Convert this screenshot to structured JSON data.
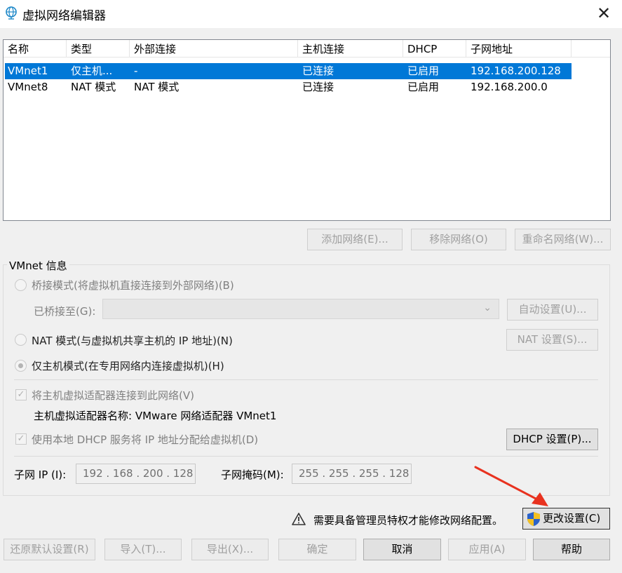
{
  "window": {
    "title": "虚拟网络编辑器",
    "close_glyph": "✕"
  },
  "list": {
    "headers": [
      "名称",
      "类型",
      "外部连接",
      "主机连接",
      "DHCP",
      "子网地址"
    ],
    "rows": [
      {
        "name": "VMnet1",
        "type": "仅主机...",
        "external": "-",
        "host": "已连接",
        "dhcp": "已启用",
        "subnet": "192.168.200.128",
        "selected": true
      },
      {
        "name": "VMnet8",
        "type": "NAT 模式",
        "external": "NAT 模式",
        "host": "已连接",
        "dhcp": "已启用",
        "subnet": "192.168.200.0",
        "selected": false
      }
    ]
  },
  "list_buttons": {
    "add": "添加网络(E)...",
    "remove": "移除网络(O)",
    "rename": "重命名网络(W)..."
  },
  "vmnet_info": {
    "group_label": "VMnet 信息",
    "bridge_mode": "桥接模式(将虚拟机直接连接到外部网络)(B)",
    "bridged_to_label": "已桥接至(G):",
    "auto_settings": "自动设置(U)...",
    "nat_mode": "NAT 模式(与虚拟机共享主机的 IP 地址)(N)",
    "nat_settings": "NAT 设置(S)...",
    "host_only_mode": "仅主机模式(在专用网络内连接虚拟机)(H)",
    "connect_adapter": "将主机虚拟适配器连接到此网络(V)",
    "adapter_name": "主机虚拟适配器名称: VMware 网络适配器 VMnet1",
    "use_dhcp": "使用本地 DHCP 服务将 IP 地址分配给虚拟机(D)",
    "dhcp_settings": "DHCP 设置(P)...",
    "subnet_ip_label": "子网 IP (I):",
    "subnet_ip": "192 . 168 . 200 . 128",
    "subnet_mask_label": "子网掩码(M):",
    "subnet_mask": "255 . 255 . 255 . 128"
  },
  "admin_notice": {
    "text": "需要具备管理员特权才能修改网络配置。",
    "change_settings": "更改设置(C)"
  },
  "footer_buttons": {
    "restore_defaults": "还原默认设置(R)",
    "import": "导入(T)...",
    "export": "导出(X)...",
    "ok": "确定",
    "cancel": "取消",
    "apply": "应用(A)",
    "help": "帮助"
  },
  "colors": {
    "selection": "#0078d7",
    "arrow": "#e8321f"
  },
  "icons": {
    "app": "network-globe-icon",
    "warning": "warning-triangle-icon",
    "uac": "uac-shield-icon"
  }
}
